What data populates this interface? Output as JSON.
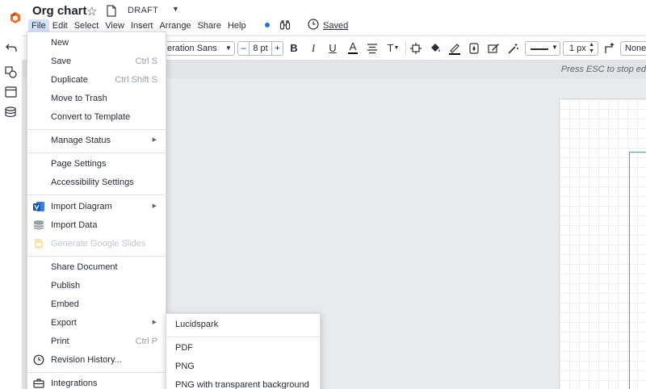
{
  "document": {
    "title": "Org chart",
    "status": "DRAFT",
    "saved_label": "Saved"
  },
  "menubar": [
    "File",
    "Edit",
    "Select",
    "View",
    "Insert",
    "Arrange",
    "Share",
    "Help"
  ],
  "toolbar": {
    "font": "eration Sans",
    "font_size": "8 pt",
    "line_width": "1 px",
    "arrow_style": "None"
  },
  "hint": "Press ESC to stop ed",
  "file_menu": {
    "new": "New",
    "save": "Save",
    "save_shortcut": "Ctrl S",
    "duplicate": "Duplicate",
    "duplicate_shortcut": "Ctrl Shift S",
    "move_to_trash": "Move to Trash",
    "convert_to_template": "Convert to Template",
    "manage_status": "Manage Status",
    "page_settings": "Page Settings",
    "accessibility_settings": "Accessibility Settings",
    "import_diagram": "Import Diagram",
    "import_data": "Import Data",
    "generate_google_slides": "Generate Google Slides",
    "share_document": "Share Document",
    "publish": "Publish",
    "embed": "Embed",
    "export": "Export",
    "print": "Print",
    "print_shortcut": "Ctrl P",
    "revision_history": "Revision History...",
    "integrations": "Integrations"
  },
  "export_submenu": {
    "lucidspark": "Lucidspark",
    "pdf": "PDF",
    "png": "PNG",
    "png_transparent": "PNG with transparent background"
  },
  "colors": {
    "accent": "#1a73e8",
    "logo": "#f06a22",
    "menu_active": "#d4e3fb",
    "selection": "#3aa5b8"
  }
}
